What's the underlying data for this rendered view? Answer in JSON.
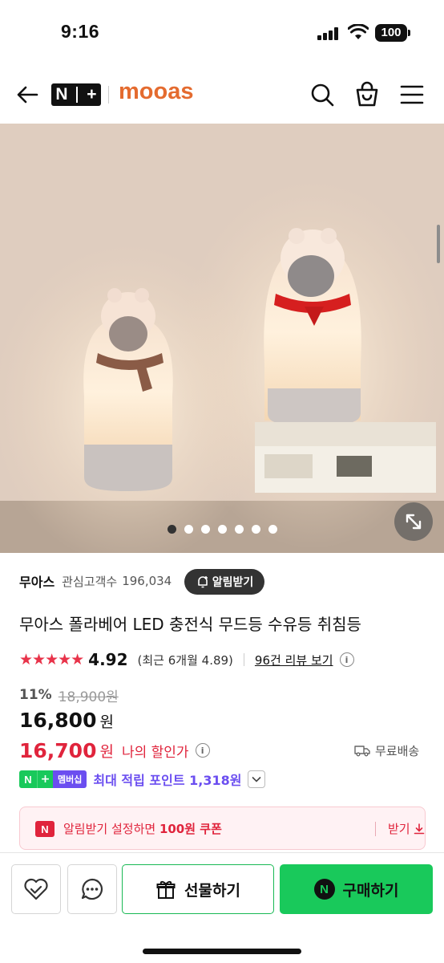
{
  "status_bar": {
    "time": "9:16",
    "battery": "100"
  },
  "header": {
    "store_badge_n": "N",
    "store_badge_plus": "+",
    "brand_logo": "mooas",
    "icons": [
      "back-arrow-icon",
      "search-icon",
      "shopping-bag-icon",
      "hamburger-menu-icon"
    ]
  },
  "gallery": {
    "slide_count": 7,
    "active_slide": 1,
    "expand_icon": "expand-arrows-icon"
  },
  "product": {
    "brand": "무아스",
    "follower_label": "관심고객수",
    "follower_count": "196,034",
    "alert_button": "알림받기",
    "title": "무아스 폴라베어 LED 충전식 무드등 수유등 취침등"
  },
  "rating": {
    "stars": "★★★★★",
    "value": "4.92",
    "recent": "(최근 6개월 4.89)",
    "review_link": "96건 리뷰 보기",
    "info": "i"
  },
  "price": {
    "discount_rate": "11%",
    "original": "18,900원",
    "sale": "16,800",
    "won": "원",
    "my_price": "16,700",
    "my_won": "원",
    "my_label": "나의 할인가",
    "shipping": "무료배송"
  },
  "points": {
    "badge_n": "N",
    "badge_plus": "+",
    "badge_label": "멤버십",
    "text": "최대 적립 포인트 1,318원"
  },
  "coupon": {
    "icon_text": "N",
    "text_pre": "알림받기 설정하면 ",
    "text_bold": "100원 쿠폰",
    "action": "받기"
  },
  "bottom_bar": {
    "gift_label": "선물하기",
    "buy_badge": "N",
    "buy_label": "구매하기"
  },
  "colors": {
    "brand_orange": "#e46b2f",
    "sale_red": "#e0243c",
    "naver_green": "#19c95b",
    "membership_purple": "#6b4ef0"
  }
}
